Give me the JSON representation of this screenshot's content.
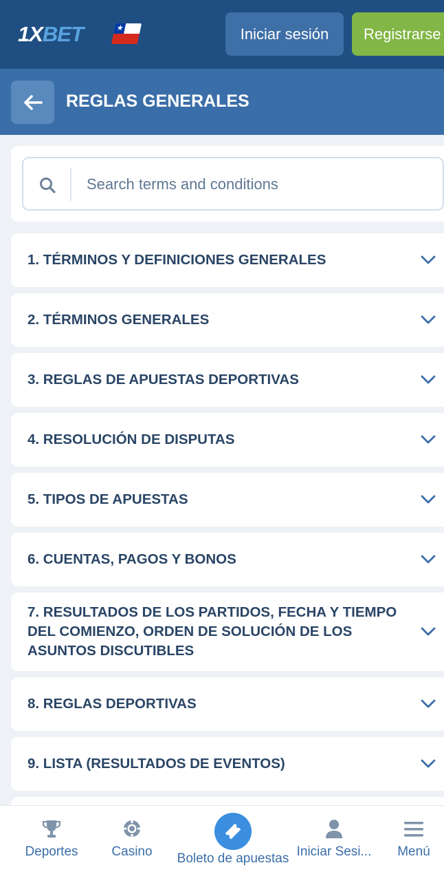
{
  "header": {
    "logo_text_a": "1X",
    "logo_text_b": "BET",
    "login_label": "Iniciar sesión",
    "register_label": "Registrarse"
  },
  "titlebar": {
    "title": "REGLAS GENERALES"
  },
  "search": {
    "placeholder": "Search terms and conditions"
  },
  "sections": [
    {
      "label": "1. TÉRMINOS Y DEFINICIONES GENERALES"
    },
    {
      "label": "2. TÉRMINOS GENERALES"
    },
    {
      "label": "3. REGLAS DE APUESTAS DEPORTIVAS"
    },
    {
      "label": "4. RESOLUCIÓN DE DISPUTAS"
    },
    {
      "label": "5. TIPOS DE APUESTAS"
    },
    {
      "label": "6. CUENTAS, PAGOS Y BONOS"
    },
    {
      "label": "7. RESULTADOS DE LOS PARTIDOS, FECHA Y TIEMPO DEL COMIENZO, ORDEN DE SOLUCIÓN DE LOS ASUNTOS DISCUTIBLES"
    },
    {
      "label": "8. REGLAS DEPORTIVAS"
    },
    {
      "label": "9. LISTA (RESULTADOS DE EVENTOS)"
    }
  ],
  "bottom_nav": {
    "sports": "Deportes",
    "casino": "Casino",
    "betslip": "Boleto de apuestas",
    "login": "Iniciar Sesi...",
    "menu": "Menú"
  },
  "colors": {
    "header_bg": "#1f4f82",
    "titlebar_bg": "#3a6ea8",
    "register_green": "#82b646",
    "accent_blue": "#3b8ee0",
    "text_dark": "#2a4566"
  },
  "icons": [
    "flag-chile-icon",
    "arrow-left-icon",
    "search-icon",
    "chevron-down-icon",
    "trophy-icon",
    "poker-chip-icon",
    "ticket-icon",
    "user-icon",
    "hamburger-menu-icon"
  ]
}
